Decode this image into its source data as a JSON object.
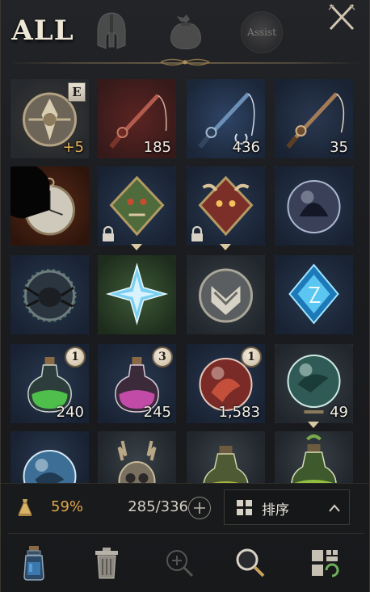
{
  "tabs": {
    "all_label": "ALL",
    "assist_label": "Assist",
    "items": [
      {
        "name": "all",
        "icon": "all-text-tab",
        "active": true
      },
      {
        "name": "equipment",
        "icon": "helmet-icon",
        "active": false
      },
      {
        "name": "materials",
        "icon": "pouch-icon",
        "active": false
      },
      {
        "name": "assist",
        "icon": "assist-icon",
        "active": false
      }
    ],
    "close_icon": "close-x-icon"
  },
  "inventory": {
    "rows": [
      [
        {
          "name": "ornate-emblem",
          "grade": "E",
          "count": "+5",
          "count_style": "gold",
          "frame": "plain",
          "theme": "dark"
        },
        {
          "name": "fishing-rod-red",
          "count": "185",
          "frame": "plain",
          "theme": "red"
        },
        {
          "name": "fishing-rod-blue",
          "count": "436",
          "frame": "plain",
          "theme": "blue"
        },
        {
          "name": "fishing-rod-wood",
          "count": "35",
          "frame": "plain",
          "theme": "navy"
        }
      ],
      [
        {
          "name": "pocket-watch",
          "count": "",
          "frame": "gold",
          "theme": "rust",
          "cooldown": 0.7
        },
        {
          "name": "monster-emblem-green",
          "count": "",
          "frame": "gold",
          "theme": "navy",
          "locked": true
        },
        {
          "name": "monster-emblem-red",
          "count": "",
          "frame": "gold",
          "theme": "navy",
          "locked": true
        },
        {
          "name": "shadow-orb",
          "count": "",
          "frame": "gold",
          "theme": "navy"
        }
      ],
      [
        {
          "name": "spider-emblem",
          "count": "",
          "frame": "gold",
          "theme": "navy"
        },
        {
          "name": "star-crystal",
          "count": "",
          "frame": "gold",
          "theme": "green"
        },
        {
          "name": "wing-shield",
          "count": "",
          "frame": "gold",
          "theme": "slate"
        },
        {
          "name": "rune-crystal",
          "count": "",
          "frame": "gold",
          "theme": "navy"
        }
      ],
      [
        {
          "name": "green-potion",
          "badge": "1",
          "count": "240",
          "frame": "blue",
          "theme": "navy"
        },
        {
          "name": "pink-potion",
          "badge": "3",
          "count": "245",
          "frame": "blue",
          "theme": "navy"
        },
        {
          "name": "crimson-orb",
          "badge": "1",
          "count": "1,583",
          "frame": "blue",
          "theme": "navy"
        },
        {
          "name": "dragon-orb",
          "count": "49",
          "frame": "sel",
          "theme": "slate"
        }
      ],
      [
        {
          "name": "blue-orb",
          "count": "",
          "frame": "plain",
          "theme": "navy"
        },
        {
          "name": "antler-mask",
          "count": "",
          "frame": "plain",
          "theme": "slate"
        },
        {
          "name": "oil-flask",
          "count": "",
          "frame": "plain",
          "theme": "slate"
        },
        {
          "name": "herb-flask",
          "count": "",
          "frame": "plain",
          "theme": "slate"
        }
      ]
    ]
  },
  "footer": {
    "weight_icon": "weight-icon",
    "weight_percent": "59%",
    "capacity": "285/336",
    "expand_icon": "plus-circle-icon",
    "sort_label": "排序",
    "sort_icon": "grid-icon",
    "sort_caret_icon": "chevron-up-icon"
  },
  "toolbar": {
    "items": [
      {
        "name": "potion",
        "icon": "potion-icon"
      },
      {
        "name": "trash",
        "icon": "trash-icon"
      },
      {
        "name": "zoom-in",
        "icon": "zoom-in-icon",
        "disabled": true
      },
      {
        "name": "search",
        "icon": "search-icon"
      },
      {
        "name": "layout",
        "icon": "layout-icon"
      }
    ]
  },
  "colors": {
    "accent_gold": "#e0a84a",
    "frame_gold": "#8d744b",
    "text_light": "#f4efe6"
  }
}
